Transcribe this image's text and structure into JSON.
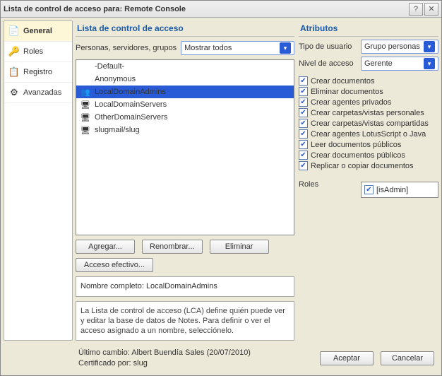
{
  "title": "Lista de control de acceso para: Remote Console",
  "sidebar": {
    "tabs": [
      {
        "label": "General",
        "icon": "📄",
        "active": true
      },
      {
        "label": "Roles",
        "icon": "🔑",
        "active": false
      },
      {
        "label": "Registro",
        "icon": "📋",
        "active": false
      },
      {
        "label": "Avanzadas",
        "icon": "⚙",
        "active": false
      }
    ]
  },
  "acl": {
    "header": "Lista de control de acceso",
    "filter_label": "Personas, servidores, grupos",
    "filter_value": "Mostrar todos",
    "items": [
      {
        "label": "-Default-",
        "icon": "",
        "sel": false
      },
      {
        "label": "Anonymous",
        "icon": "",
        "sel": false
      },
      {
        "label": "LocalDomainAdmins",
        "icon": "👥",
        "sel": true
      },
      {
        "label": "LocalDomainServers",
        "icon": "🖥",
        "sel": false
      },
      {
        "label": "OtherDomainServers",
        "icon": "🖥",
        "sel": false
      },
      {
        "label": "slugmail/slug",
        "icon": "🖥",
        "sel": false
      }
    ],
    "buttons": {
      "add": "Agregar...",
      "rename": "Renombrar...",
      "remove": "Eliminar",
      "effective": "Acceso efectivo..."
    },
    "fullname_label": "Nombre completo: ",
    "fullname_value": "LocalDomainAdmins",
    "help": "La Lista de control de acceso (LCA) define quién puede ver y editar la base de datos de Notes. Para definir o ver el acceso asignado a un nombre, selecciónelo."
  },
  "attr": {
    "header": "Atributos",
    "user_type_label": "Tipo de usuario",
    "user_type_value": "Grupo personas",
    "access_level_label": "Nivel de acceso",
    "access_level_value": "Gerente",
    "checks": [
      {
        "label": "Crear documentos",
        "on": true
      },
      {
        "label": "Eliminar documentos",
        "on": true
      },
      {
        "label": "Crear agentes privados",
        "on": true
      },
      {
        "label": "Crear carpetas/vistas personales",
        "on": true
      },
      {
        "label": "Crear carpetas/vistas compartidas",
        "on": true
      },
      {
        "label": "Crear agentes LotusScript o Java",
        "on": true
      },
      {
        "label": "Leer documentos públicos",
        "on": true
      },
      {
        "label": "Crear documentos públicos",
        "on": true
      },
      {
        "label": "Replicar o copiar documentos",
        "on": true
      }
    ],
    "roles_label": "Roles",
    "roles": [
      {
        "label": "[isAdmin]",
        "on": true
      }
    ]
  },
  "footer": {
    "last_change": "Último cambio: Albert Buendía Sales (20/07/2010)",
    "certified": "Certificado por: slug",
    "ok": "Aceptar",
    "cancel": "Cancelar"
  }
}
